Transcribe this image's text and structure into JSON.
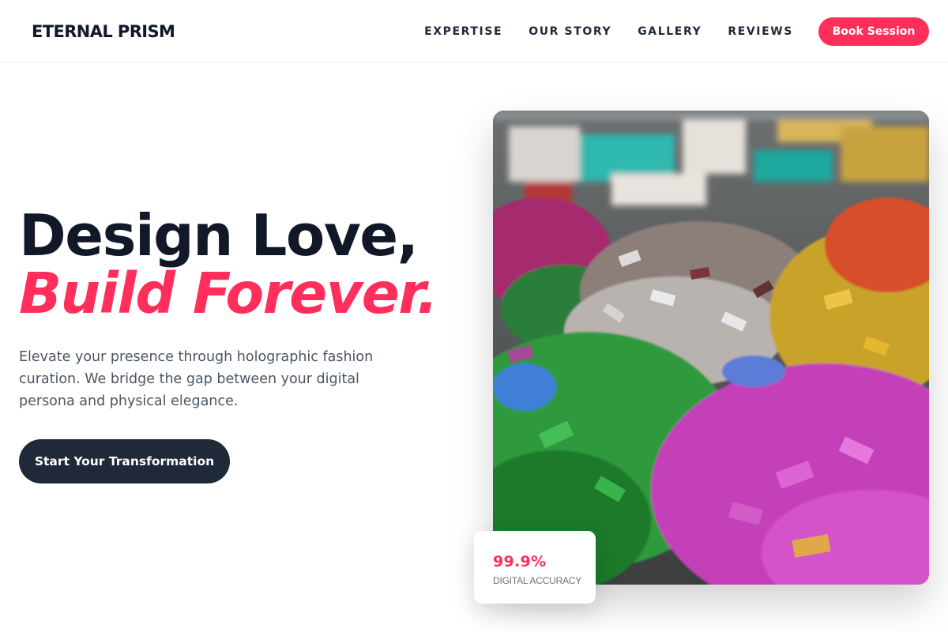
{
  "brand": {
    "name": "ETERNAL PRISM"
  },
  "nav": {
    "links": [
      "EXPERTISE",
      "OUR STORY",
      "GALLERY",
      "REVIEWS"
    ],
    "cta_label": "Book Session"
  },
  "hero": {
    "headline_line1": "Design Love,",
    "headline_line2": "Build Forever.",
    "description": "Elevate your presence through holographic fashion curation. We bridge the gap between your digital persona and physical elegance.",
    "cta_label": "Start Your Transformation",
    "image_name": "colorful-foil-wrapped-candies-photo"
  },
  "stat": {
    "value": "99.9%",
    "label": "DIGITAL ACCURACY"
  },
  "colors": {
    "accent": "#ff2e5b",
    "dark": "#1f2937",
    "text": "#111827",
    "muted": "#4b5563"
  }
}
